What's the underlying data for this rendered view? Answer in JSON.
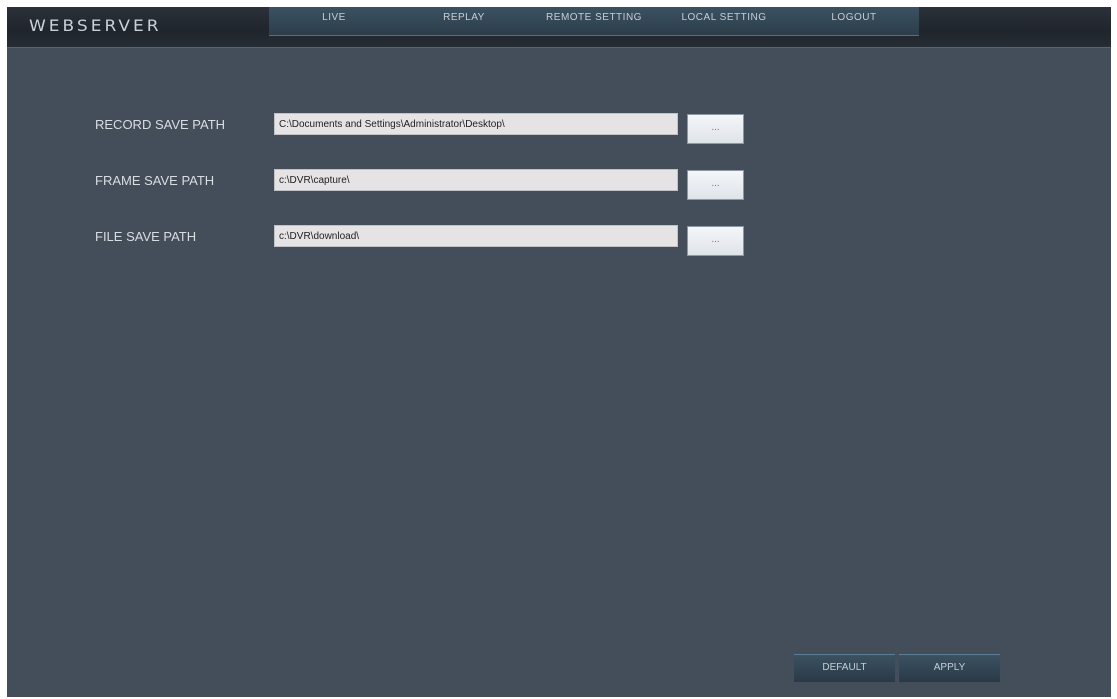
{
  "app": {
    "logo_text": "WEBSERVER"
  },
  "nav": {
    "items": [
      {
        "label": "LIVE"
      },
      {
        "label": "REPLAY"
      },
      {
        "label": "REMOTE SETTING"
      },
      {
        "label": "LOCAL SETTING"
      },
      {
        "label": "LOGOUT"
      }
    ]
  },
  "form": {
    "record_save_path": {
      "label": "RECORD SAVE PATH",
      "value": "C:\\Documents and Settings\\Administrator\\Desktop\\",
      "browse_label": "..."
    },
    "frame_save_path": {
      "label": "FRAME SAVE PATH",
      "value": "c:\\DVR\\capture\\",
      "browse_label": "..."
    },
    "file_save_path": {
      "label": "FILE SAVE PATH",
      "value": "c:\\DVR\\download\\",
      "browse_label": "..."
    }
  },
  "actions": {
    "default_label": "DEFAULT",
    "apply_label": "APPLY"
  },
  "colors": {
    "background": "#434e5a",
    "topbar": "#22282e",
    "nav": "#344755",
    "label_text": "#d8dde2",
    "input_bg": "#e6e3e4"
  }
}
